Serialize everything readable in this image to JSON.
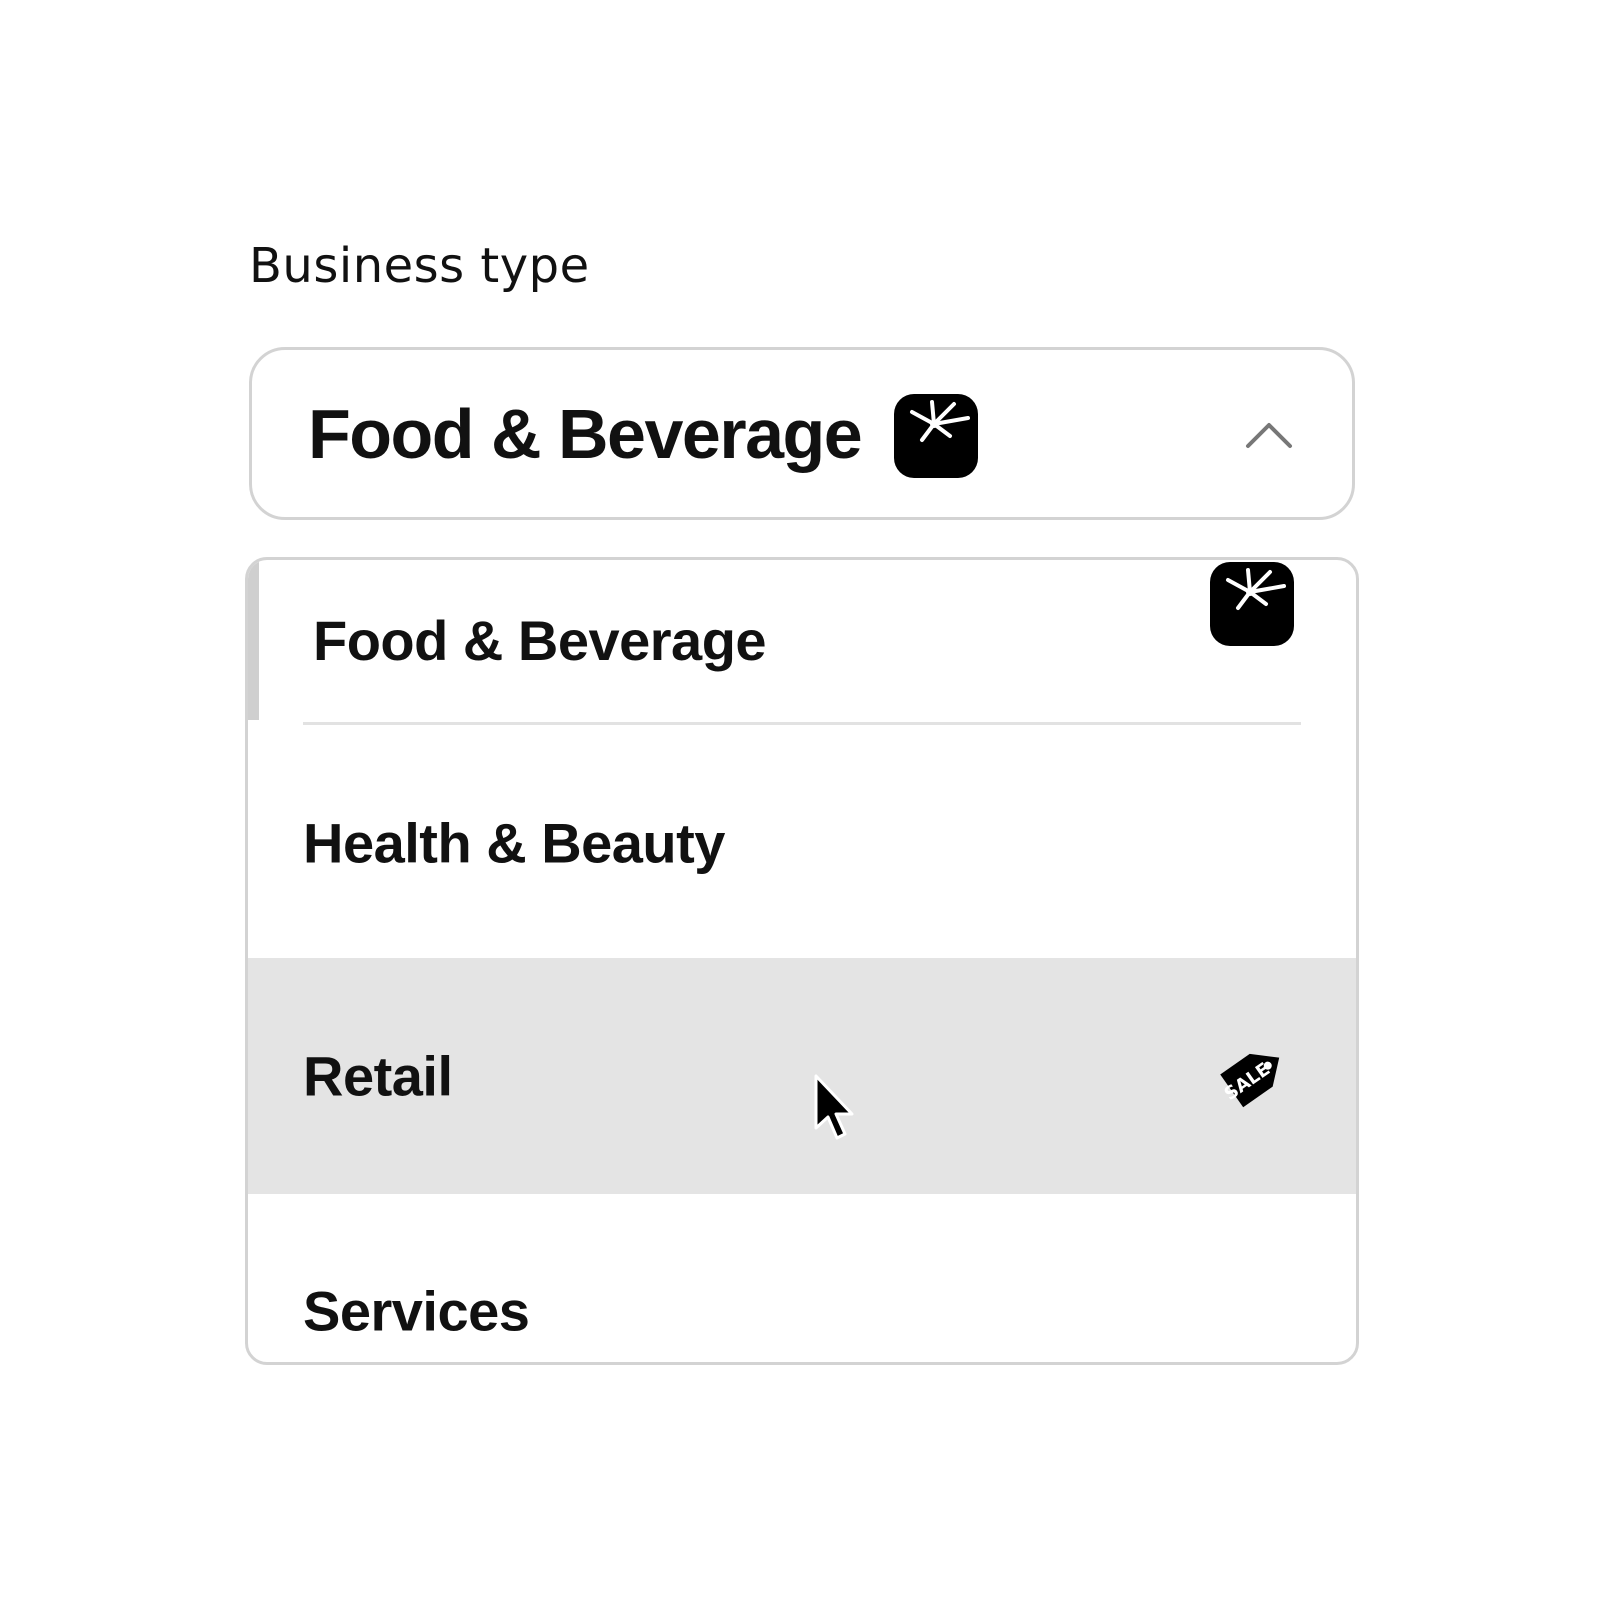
{
  "field": {
    "label": "Business type",
    "selected_value": "Food & Beverage",
    "selected_icon": "food-bowl-icon",
    "expanded": true
  },
  "options": [
    {
      "label": "Food & Beverage",
      "icon": "food-bowl-icon",
      "selected": true
    },
    {
      "label": "Health & Beauty"
    },
    {
      "label": "Retail",
      "icon": "sale-tag-icon",
      "highlighted": true,
      "icon_text": "SALE"
    },
    {
      "label": "Services"
    }
  ],
  "colors": {
    "border": "#d3d3d3",
    "hover_row": "#e4e4e4",
    "text": "#111111"
  }
}
